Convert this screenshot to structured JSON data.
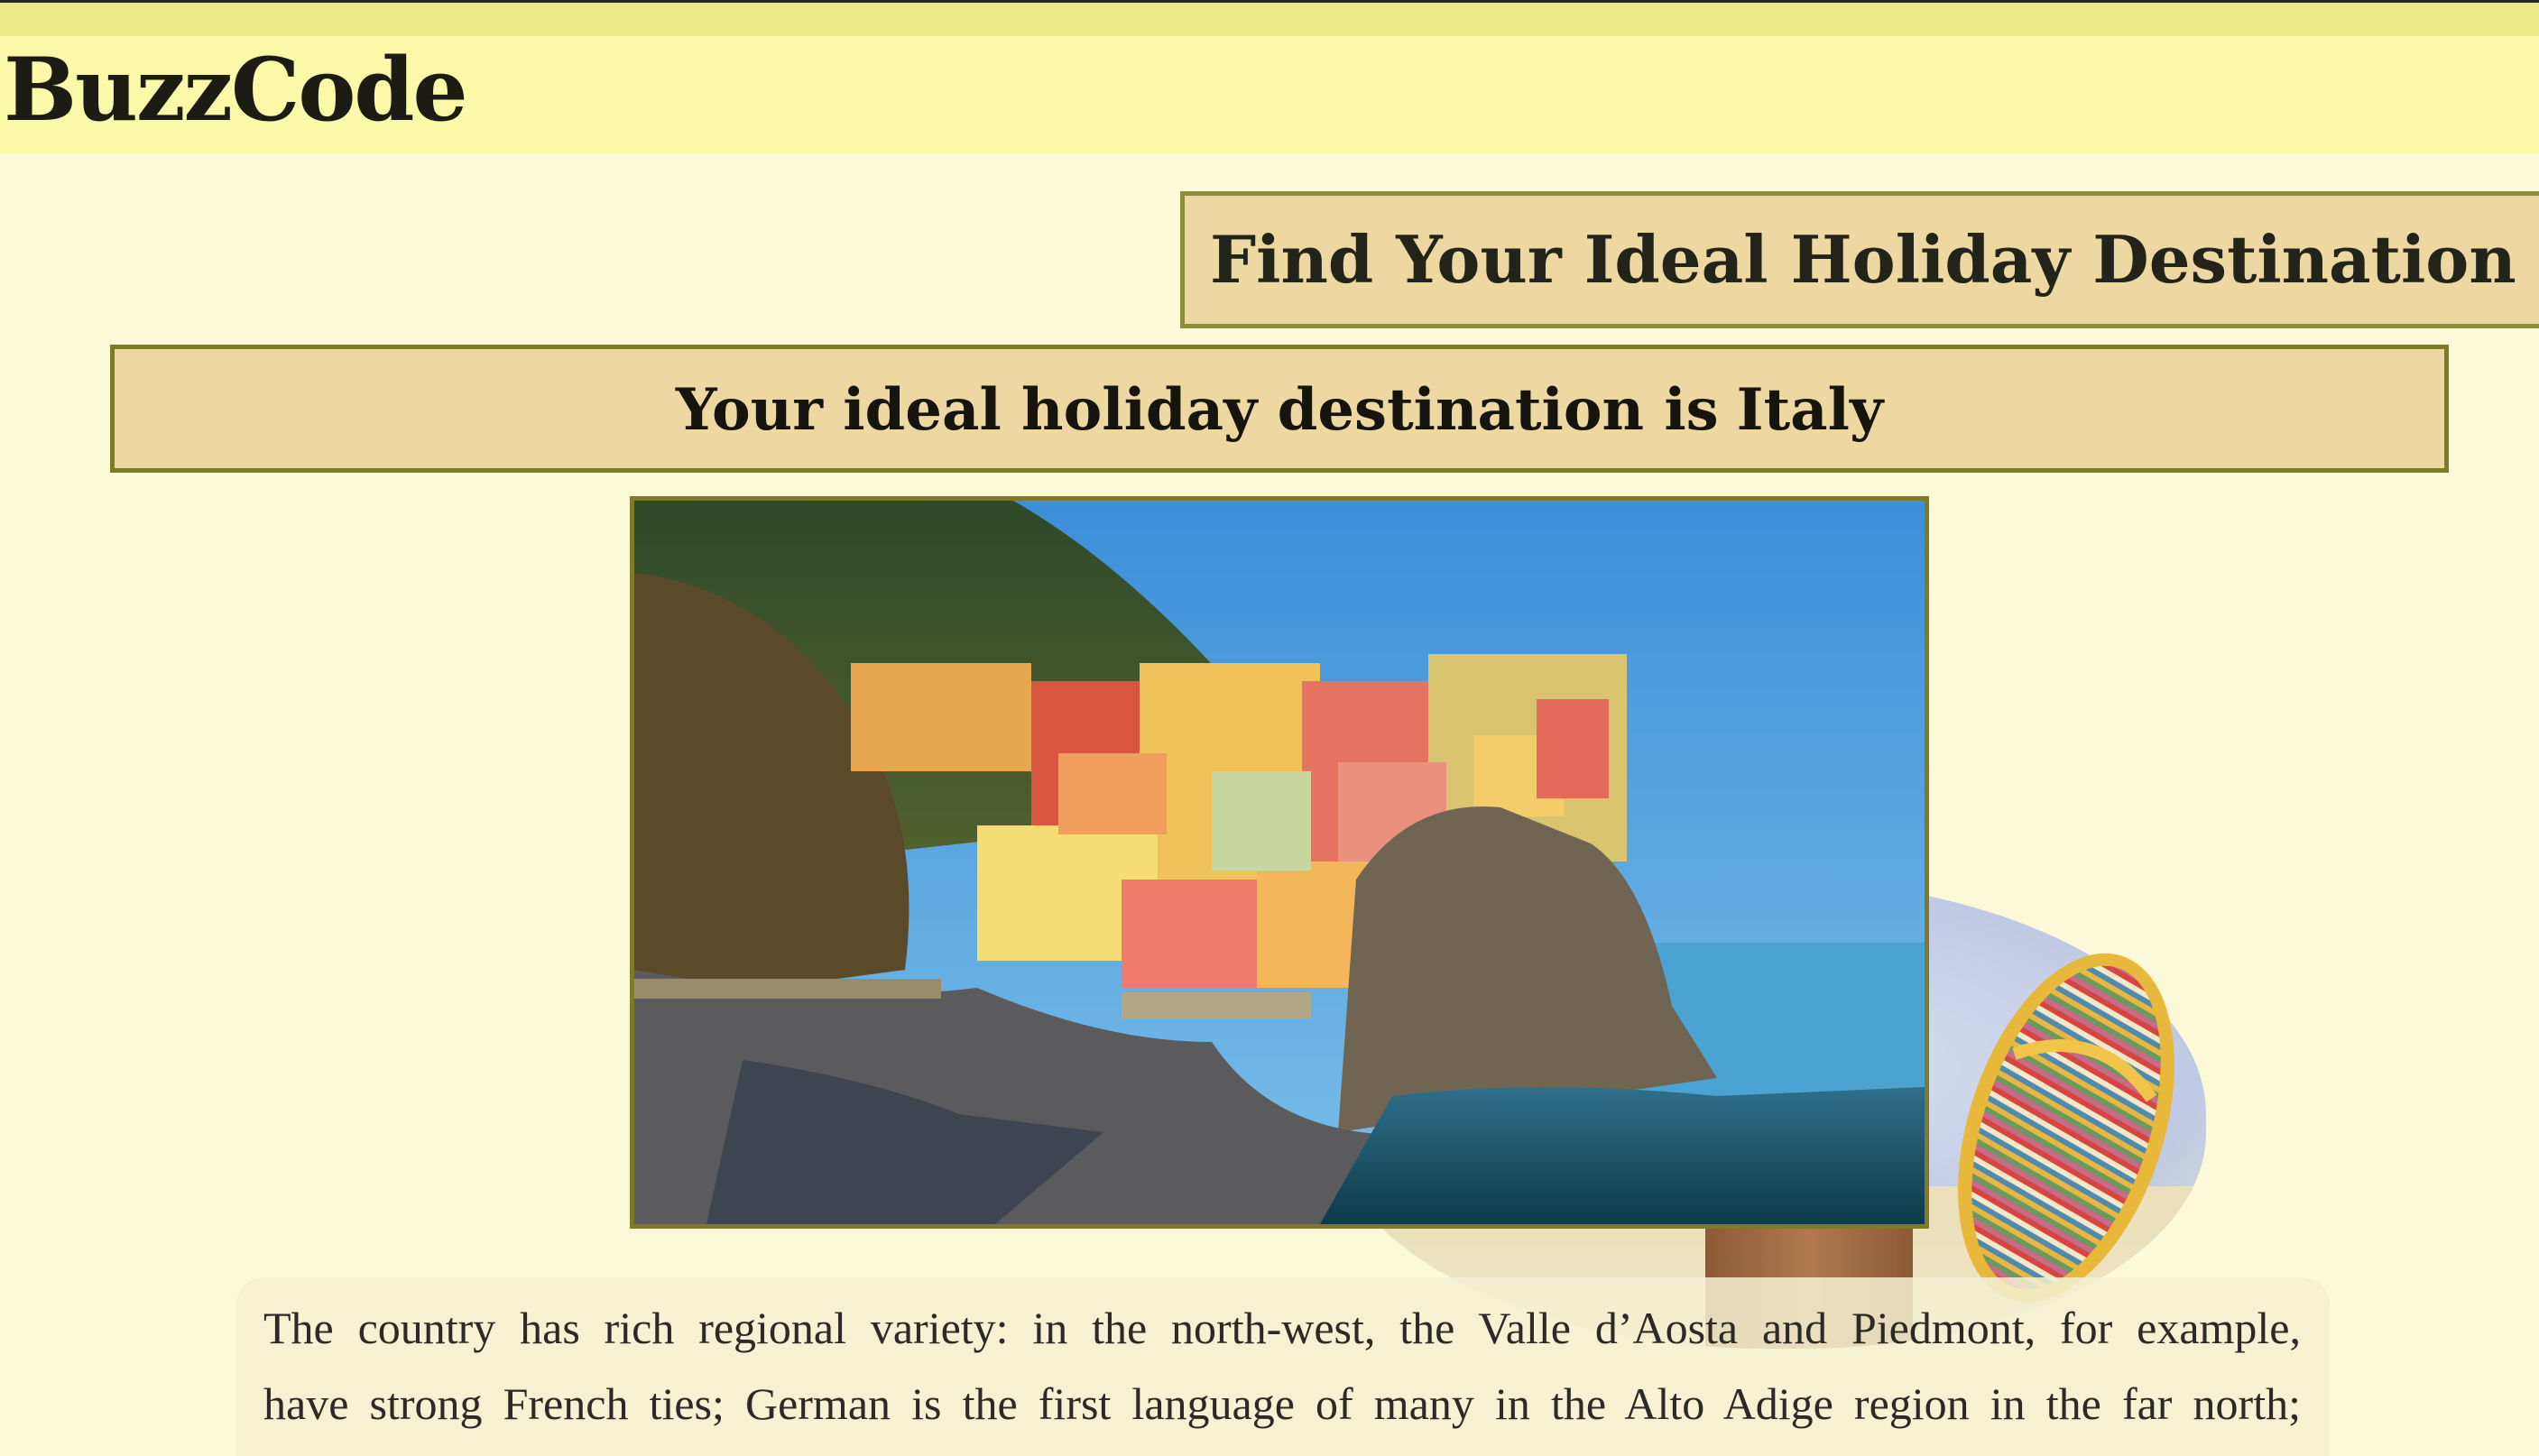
{
  "brand": "BuzzCode",
  "quiz_title": "Find Your Ideal Holiday Destination",
  "result": {
    "prefix": "Your ideal holiday destination is",
    "country": "Italy"
  },
  "photo": {
    "alt": "Manarola, Cinque Terre, Italy"
  },
  "description": {
    "line1": "The country has rich regional variety: in the north-west, the Valle d’Aosta and Piedmont, for example,",
    "line2": "have strong French ties; German is the first language of many in the Alto Adige region in the far north;"
  },
  "colors": {
    "background": "#fbf9d8",
    "header": "#fbf9a8",
    "box_fill": "#ecd8a0",
    "box_border": "#7e7a2a"
  }
}
